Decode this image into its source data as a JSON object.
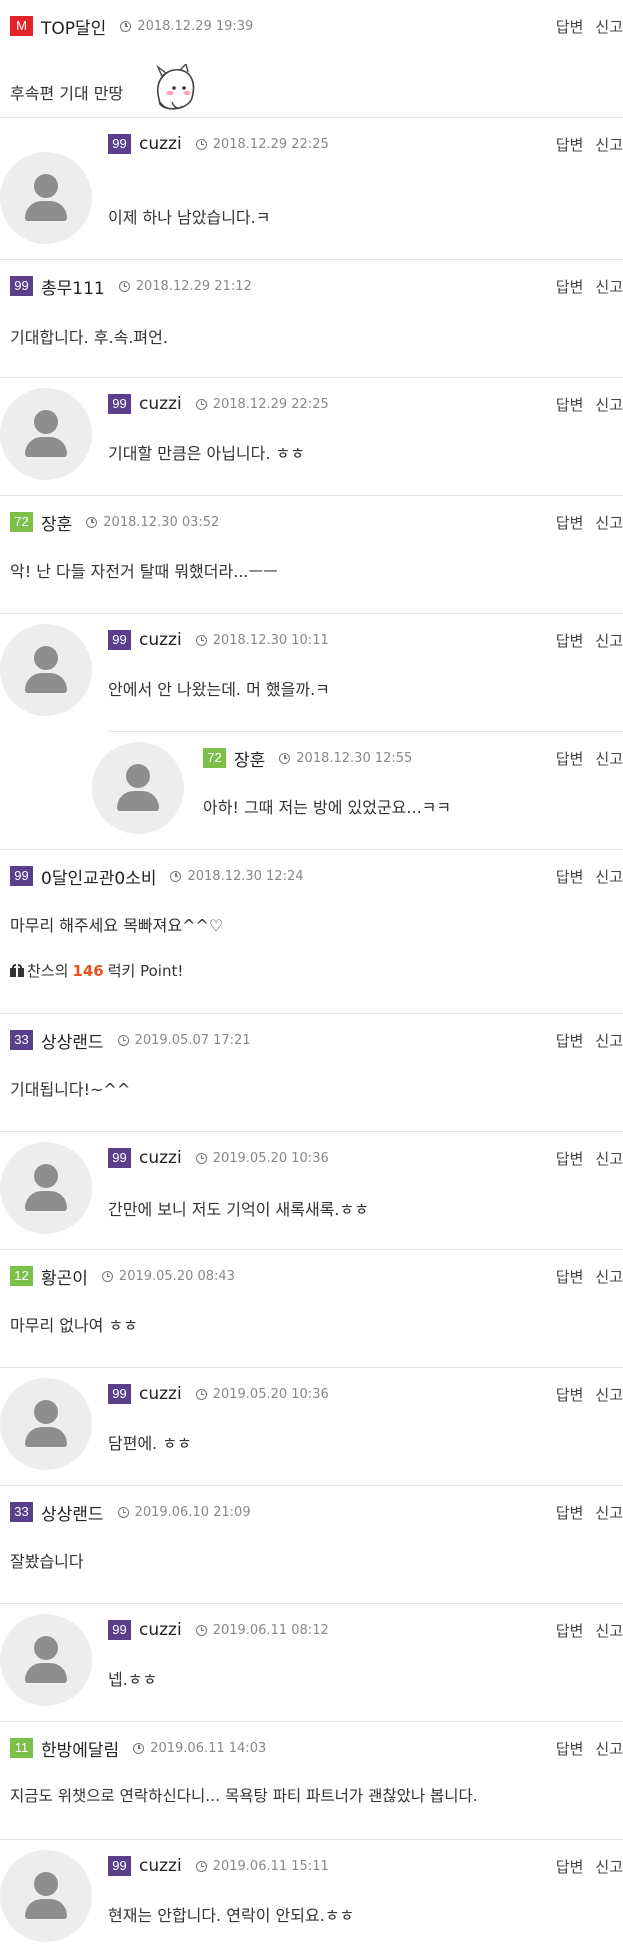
{
  "ui": {
    "reply_label": "답변",
    "report_label": "신고"
  },
  "colors": {
    "purple": "#5b3f8b",
    "green": "#7cc04b",
    "red": "#e0242a",
    "point": "#e8541e"
  },
  "comments": [
    {
      "badge": "M",
      "badge_color": "#e0242a",
      "nick": "TOP달인",
      "date": "2018.12.29 19:39",
      "text": "후속편 기대 만땅",
      "emoticon": "blushing-character-emoticon"
    },
    {
      "badge": "99",
      "badge_color": "#5b3f8b",
      "nick": "cuzzi",
      "date": "2018.12.29 22:25",
      "text": "이제 하나 남았습니다.ㅋ"
    },
    {
      "badge": "99",
      "badge_color": "#5b3f8b",
      "nick": "총무111",
      "date": "2018.12.29 21:12",
      "text": "기대합니다. 후.속.펴언."
    },
    {
      "badge": "99",
      "badge_color": "#5b3f8b",
      "nick": "cuzzi",
      "date": "2018.12.29 22:25",
      "text": "기대할 만큼은 아닙니다. ㅎㅎ"
    },
    {
      "badge": "72",
      "badge_color": "#7cc04b",
      "nick": "장훈",
      "date": "2018.12.30 03:52",
      "text": "악! 난 다들 자전거 탈때 뭐했더라...ㅡㅡ"
    },
    {
      "badge": "99",
      "badge_color": "#5b3f8b",
      "nick": "cuzzi",
      "date": "2018.12.30 10:11",
      "text": "안에서 안 나왔는데. 머 했을까.ㅋ"
    },
    {
      "badge": "72",
      "badge_color": "#7cc04b",
      "nick": "장훈",
      "date": "2018.12.30 12:55",
      "text": "아하! 그때 저는 방에 있었군요...ㅋㅋ"
    },
    {
      "badge": "99",
      "badge_color": "#5b3f8b",
      "nick": "0달인교관0소비",
      "date": "2018.12.30 12:24",
      "text": "마무리 해주세요 목빠져요^^♡",
      "point_prefix": "찬스의",
      "point_value": "146",
      "point_suffix": "럭키 Point!"
    },
    {
      "badge": "33",
      "badge_color": "#5b3f8b",
      "nick": "상상랜드",
      "date": "2019.05.07 17:21",
      "text": "기대됩니다!~^^"
    },
    {
      "badge": "99",
      "badge_color": "#5b3f8b",
      "nick": "cuzzi",
      "date": "2019.05.20 10:36",
      "text": "간만에 보니 저도 기억이 새록새록.ㅎㅎ"
    },
    {
      "badge": "12",
      "badge_color": "#7cc04b",
      "nick": "황곤이",
      "date": "2019.05.20 08:43",
      "text": "마무리 없나여 ㅎㅎ"
    },
    {
      "badge": "99",
      "badge_color": "#5b3f8b",
      "nick": "cuzzi",
      "date": "2019.05.20 10:36",
      "text": "담편에. ㅎㅎ"
    },
    {
      "badge": "33",
      "badge_color": "#5b3f8b",
      "nick": "상상랜드",
      "date": "2019.06.10 21:09",
      "text": "잘봤습니다"
    },
    {
      "badge": "99",
      "badge_color": "#5b3f8b",
      "nick": "cuzzi",
      "date": "2019.06.11 08:12",
      "text": "넵.ㅎㅎ"
    },
    {
      "badge": "11",
      "badge_color": "#7cc04b",
      "nick": "한방에달림",
      "date": "2019.06.11 14:03",
      "text": "지금도 위챗으로 연락하신다니... 목욕탕 파티 파트너가 괜찮았나 봅니다."
    },
    {
      "badge": "99",
      "badge_color": "#5b3f8b",
      "nick": "cuzzi",
      "date": "2019.06.11 15:11",
      "text": "현재는 안합니다. 연락이 안되요.ㅎㅎ"
    }
  ]
}
